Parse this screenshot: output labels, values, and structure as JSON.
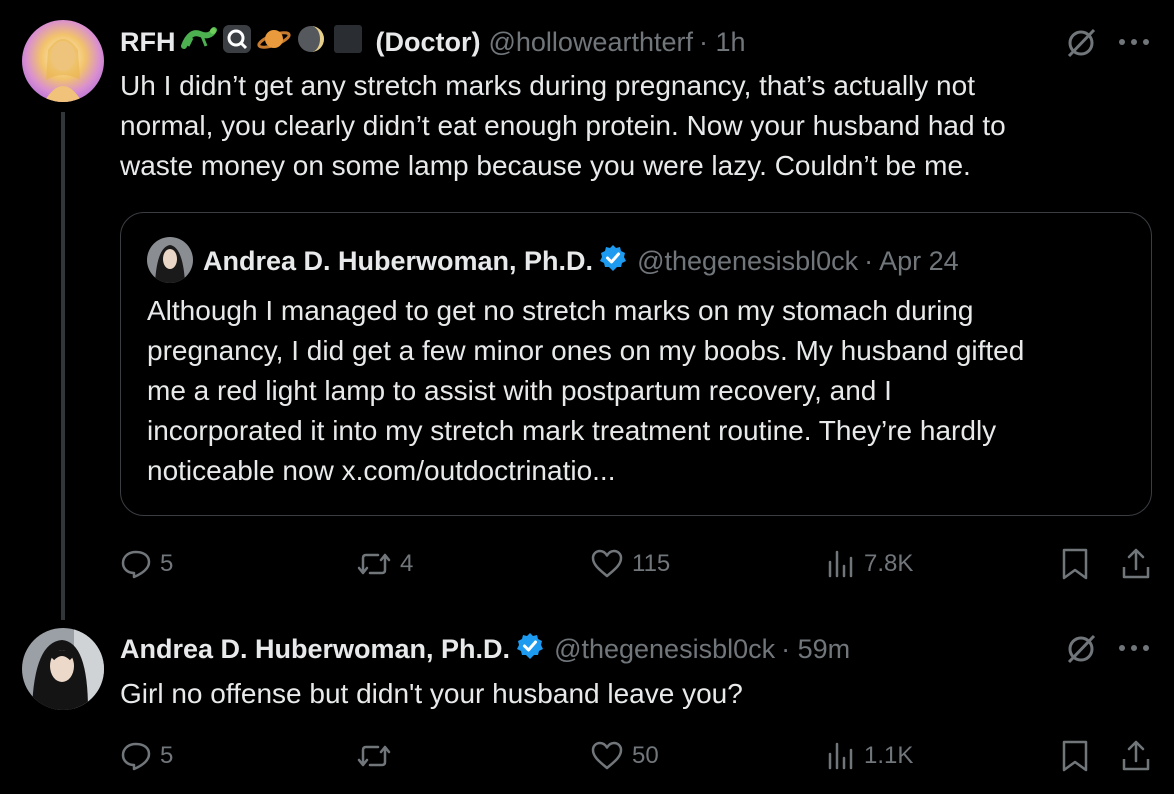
{
  "tweet1": {
    "name": "RFH",
    "badge": "(Doctor)",
    "handle": "@hollowearthterf",
    "time": "· 1h",
    "text": "Uh I didn’t get any stretch marks during pregnancy, that’s actually not\nnormal, you clearly didn’t eat enough protein. Now your husband had to\nwaste money on some lamp because you were lazy.  Couldn’t be me.",
    "quote": {
      "name": "Andrea D. Huberwoman, Ph.D.",
      "handle": "@thegenesisbl0ck",
      "time": "· Apr 24",
      "text": "Although I managed to get no stretch marks on my stomach during\npregnancy, I did get a few minor ones on my boobs. My husband gifted\nme a red light lamp to assist with postpartum recovery, and I\nincorporated it into my stretch mark treatment routine. They’re hardly\nnoticeable now x.com/outdoctrinatio..."
    },
    "actions": {
      "replies": "5",
      "reposts": "4",
      "likes": "115",
      "views": "7.8K"
    }
  },
  "tweet2": {
    "name": "Andrea D. Huberwoman, Ph.D.",
    "handle": "@thegenesisbl0ck",
    "time": "· 59m",
    "text": "Girl no offense but didn't your husband leave you?",
    "actions": {
      "replies": "5",
      "reposts": "",
      "likes": "50",
      "views": "1.1K"
    }
  },
  "colors": {
    "background": "#000000",
    "text": "#e7e9ea",
    "muted": "#71767b",
    "verified": "#1d9bf0",
    "border": "#3a3d42"
  },
  "icons": [
    "lizard-emoji",
    "magnifier-emoji",
    "ringed-planet-emoji",
    "moon-emoji",
    "black-square-emoji",
    "verified-badge-icon",
    "grok-icon",
    "more-icon",
    "reply-icon",
    "repost-icon",
    "like-icon",
    "views-icon",
    "bookmark-icon",
    "share-icon"
  ]
}
